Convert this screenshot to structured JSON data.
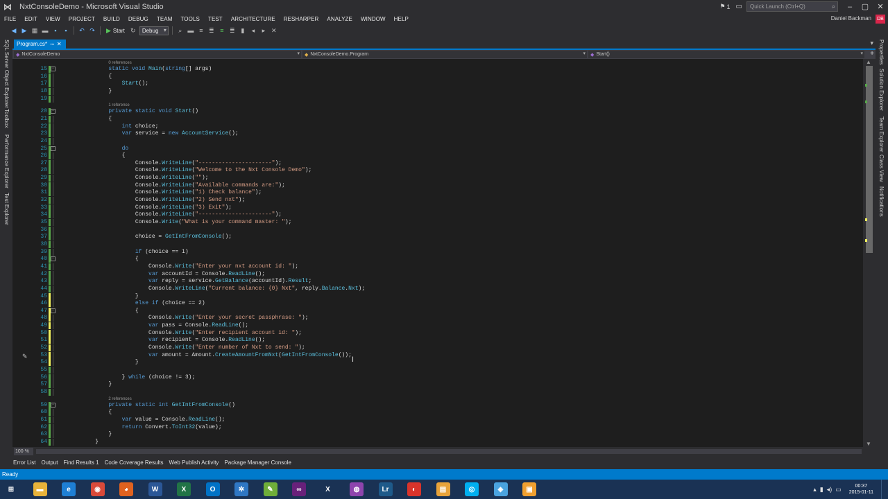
{
  "window": {
    "title": "NxtConsoleDemo - Microsoft Visual Studio",
    "notification_count": "1",
    "quick_launch_placeholder": "Quick Launch (Ctrl+Q)",
    "user_name": "Daniel Backman",
    "user_initials": "DB"
  },
  "menu": [
    "FILE",
    "EDIT",
    "VIEW",
    "PROJECT",
    "BUILD",
    "DEBUG",
    "TEAM",
    "TOOLS",
    "TEST",
    "ARCHITECTURE",
    "RESHARPER",
    "ANALYZE",
    "WINDOW",
    "HELP"
  ],
  "toolbar": {
    "start_label": "Start",
    "configuration": "Debug"
  },
  "left_tool_windows": [
    "SQL Server Object Explorer",
    "Toolbox",
    "Performance Explorer",
    "Test Explorer"
  ],
  "right_tool_windows": [
    "Properties",
    "Solution Explorer",
    "Team Explorer",
    "Class View",
    "Notifications"
  ],
  "document_tab": {
    "label": "Program.cs*",
    "pin": "⊸",
    "close": "✕"
  },
  "navigation": {
    "project": "NxtConsoleDemo",
    "type": "NxtConsoleDemo.Program",
    "member": "Start()"
  },
  "code": {
    "lines": [
      {
        "n": "15",
        "lens": "0 references",
        "text": "        static void Main(string[] args)"
      },
      {
        "n": "16",
        "text": "        {"
      },
      {
        "n": "17",
        "text": "            Start();"
      },
      {
        "n": "18",
        "text": "        }"
      },
      {
        "n": "19",
        "text": ""
      },
      {
        "n": "20",
        "lens": "1 reference",
        "text": "        private static void Start()"
      },
      {
        "n": "21",
        "text": "        {"
      },
      {
        "n": "22",
        "text": "            int choice;"
      },
      {
        "n": "23",
        "text": "            var service = new AccountService();"
      },
      {
        "n": "24",
        "text": ""
      },
      {
        "n": "25",
        "text": "            do"
      },
      {
        "n": "26",
        "text": "            {"
      },
      {
        "n": "27",
        "text": "                Console.WriteLine(\"----------------------\");"
      },
      {
        "n": "28",
        "text": "                Console.WriteLine(\"Welcome to the Nxt Console Demo\");"
      },
      {
        "n": "29",
        "text": "                Console.WriteLine(\"\");"
      },
      {
        "n": "30",
        "text": "                Console.WriteLine(\"Available commands are:\");"
      },
      {
        "n": "31",
        "text": "                Console.WriteLine(\"1) Check balance\");"
      },
      {
        "n": "32",
        "text": "                Console.WriteLine(\"2) Send nxt\");"
      },
      {
        "n": "33",
        "text": "                Console.WriteLine(\"3) Exit\");"
      },
      {
        "n": "34",
        "text": "                Console.WriteLine(\"----------------------\");"
      },
      {
        "n": "35",
        "text": "                Console.Write(\"What is your command master: \");"
      },
      {
        "n": "36",
        "text": ""
      },
      {
        "n": "37",
        "text": "                choice = GetIntFromConsole();"
      },
      {
        "n": "38",
        "text": ""
      },
      {
        "n": "39",
        "text": "                if (choice == 1)"
      },
      {
        "n": "40",
        "text": "                {"
      },
      {
        "n": "41",
        "text": "                    Console.Write(\"Enter your nxt account id: \");"
      },
      {
        "n": "42",
        "text": "                    var accountId = Console.ReadLine();"
      },
      {
        "n": "43",
        "text": "                    var reply = service.GetBalance(accountId).Result;"
      },
      {
        "n": "44",
        "text": "                    Console.WriteLine(\"Current balance: {0} Nxt\", reply.Balance.Nxt);"
      },
      {
        "n": "45",
        "text": "                }"
      },
      {
        "n": "46",
        "text": "                else if (choice == 2)"
      },
      {
        "n": "47",
        "text": "                {"
      },
      {
        "n": "48",
        "text": "                    Console.Write(\"Enter your secret passphrase: \");"
      },
      {
        "n": "49",
        "text": "                    var pass = Console.ReadLine();"
      },
      {
        "n": "50",
        "text": "                    Console.Write(\"Enter recipient account id: \");"
      },
      {
        "n": "51",
        "text": "                    var recipient = Console.ReadLine();"
      },
      {
        "n": "52",
        "text": "                    Console.Write(\"Enter number of Nxt to send: \");"
      },
      {
        "n": "53",
        "text": "                    var amount = Amount.CreateAmountFromNxt(GetIntFromConsole());"
      },
      {
        "n": "54",
        "text": "                }"
      },
      {
        "n": "55",
        "text": ""
      },
      {
        "n": "56",
        "text": "            } while (choice != 3);"
      },
      {
        "n": "57",
        "text": "        }"
      },
      {
        "n": "58",
        "text": ""
      },
      {
        "n": "59",
        "lens": "2 references",
        "text": "        private static int GetIntFromConsole()"
      },
      {
        "n": "60",
        "text": "        {"
      },
      {
        "n": "61",
        "text": "            var value = Console.ReadLine();"
      },
      {
        "n": "62",
        "text": "            return Convert.ToInt32(value);"
      },
      {
        "n": "63",
        "text": "        }"
      },
      {
        "n": "64",
        "text": "    }"
      }
    ]
  },
  "editor": {
    "zoom": "100 %"
  },
  "tool_tabs": [
    "Error List",
    "Output",
    "Find Results 1",
    "Code Coverage Results",
    "Web Publish Activity",
    "Package Manager Console"
  ],
  "status": {
    "text": "Ready"
  },
  "taskbar": {
    "apps": [
      {
        "name": "windows-start-icon",
        "glyph": "⊞",
        "color": "#1a3254"
      },
      {
        "name": "file-explorer-icon",
        "glyph": "▬",
        "color": "#e8b33a"
      },
      {
        "name": "internet-explorer-icon",
        "glyph": "e",
        "color": "#1e7fd4"
      },
      {
        "name": "chrome-icon",
        "glyph": "◉",
        "color": "#d94a3a"
      },
      {
        "name": "firefox-icon",
        "glyph": "◕",
        "color": "#e0621f"
      },
      {
        "name": "word-icon",
        "glyph": "W",
        "color": "#2b5797"
      },
      {
        "name": "excel-icon",
        "glyph": "X",
        "color": "#217346"
      },
      {
        "name": "outlook-icon",
        "glyph": "O",
        "color": "#0072c6"
      },
      {
        "name": "network-icon",
        "glyph": "✲",
        "color": "#2f77c4"
      },
      {
        "name": "notepad-icon",
        "glyph": "✎",
        "color": "#6fae3a"
      },
      {
        "name": "visual-studio-icon",
        "glyph": "∞",
        "color": "#68217a"
      },
      {
        "name": "xamarin-icon",
        "glyph": "X",
        "color": "#1a3254"
      },
      {
        "name": "globe-icon",
        "glyph": "◍",
        "color": "#8e44ad"
      },
      {
        "name": "live-writer-icon",
        "glyph": "Lr",
        "color": "#1e5a8a"
      },
      {
        "name": "media-icon",
        "glyph": "◐",
        "color": "#d9342b"
      },
      {
        "name": "folder-icon",
        "glyph": "▤",
        "color": "#e8a33a"
      },
      {
        "name": "skype-icon",
        "glyph": "◎",
        "color": "#00aff0"
      },
      {
        "name": "paint-icon",
        "glyph": "◈",
        "color": "#4aa3df"
      },
      {
        "name": "photos-icon",
        "glyph": "▣",
        "color": "#f0a030"
      }
    ],
    "time": "00:37",
    "date": "2015-01-11"
  },
  "colors": {
    "accent": "#007acc",
    "editor_bg": "#1e1e1e",
    "chrome_bg": "#2d2d30",
    "keyword": "#569cd6",
    "string": "#d69d85",
    "method": "#5bc0de",
    "line_number": "#2b91af",
    "change_saved": "#57a64a",
    "change_unsaved": "#efef5c"
  }
}
